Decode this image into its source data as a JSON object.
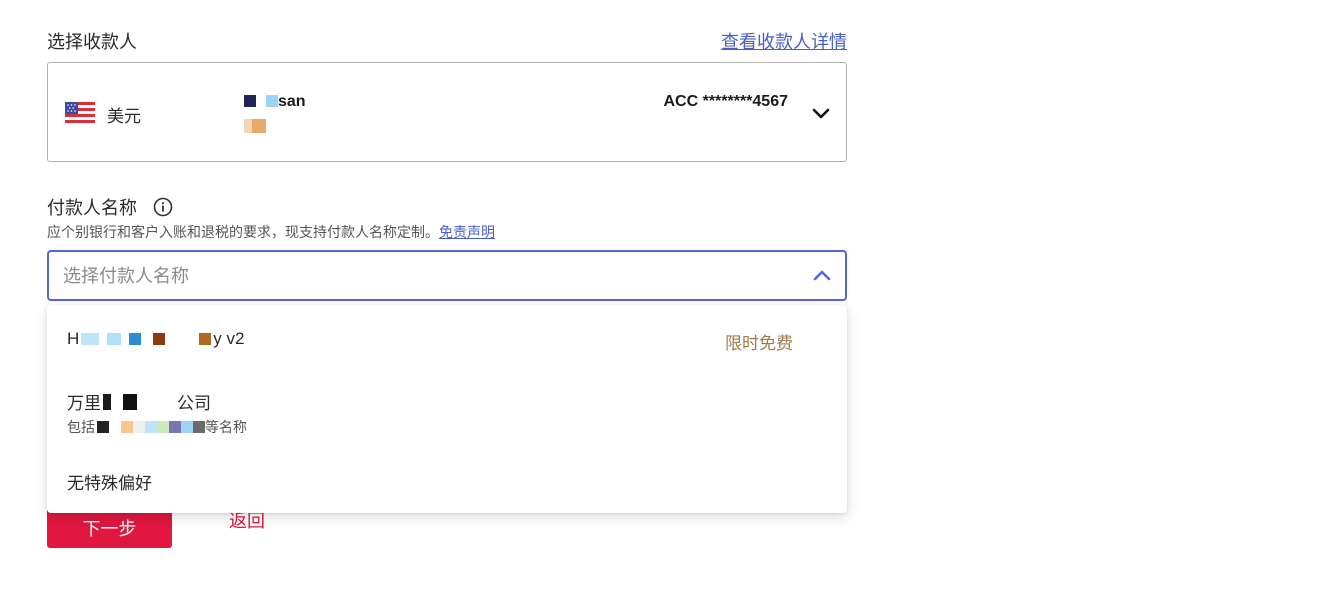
{
  "payee": {
    "section_label": "选择收款人",
    "details_link": "查看收款人详情",
    "currency": "美元",
    "name_suffix": "san",
    "account": "ACC ********4567",
    "flag_icon": "us-flag-icon"
  },
  "payer": {
    "label": "付款人名称",
    "description": "应个别银行和客户入账和退税的要求，现支持付款人名称定制。",
    "disclaimer_link": "免责声明",
    "placeholder": "选择付款人名称",
    "options": [
      {
        "text_start": "H",
        "text_end": "y v2",
        "tag": "限时免费"
      },
      {
        "text_start": "万里",
        "text_end": "公司",
        "sub_start": "包括",
        "sub_end": "等名称"
      },
      {
        "text": "无特殊偏好"
      }
    ]
  },
  "actions": {
    "next_label": "下一步",
    "back_label": "返回"
  },
  "colors": {
    "accent": "#5567d3",
    "link": "#4a5fc1",
    "primary_button": "#e0173e",
    "tag": "#a07a4c"
  }
}
